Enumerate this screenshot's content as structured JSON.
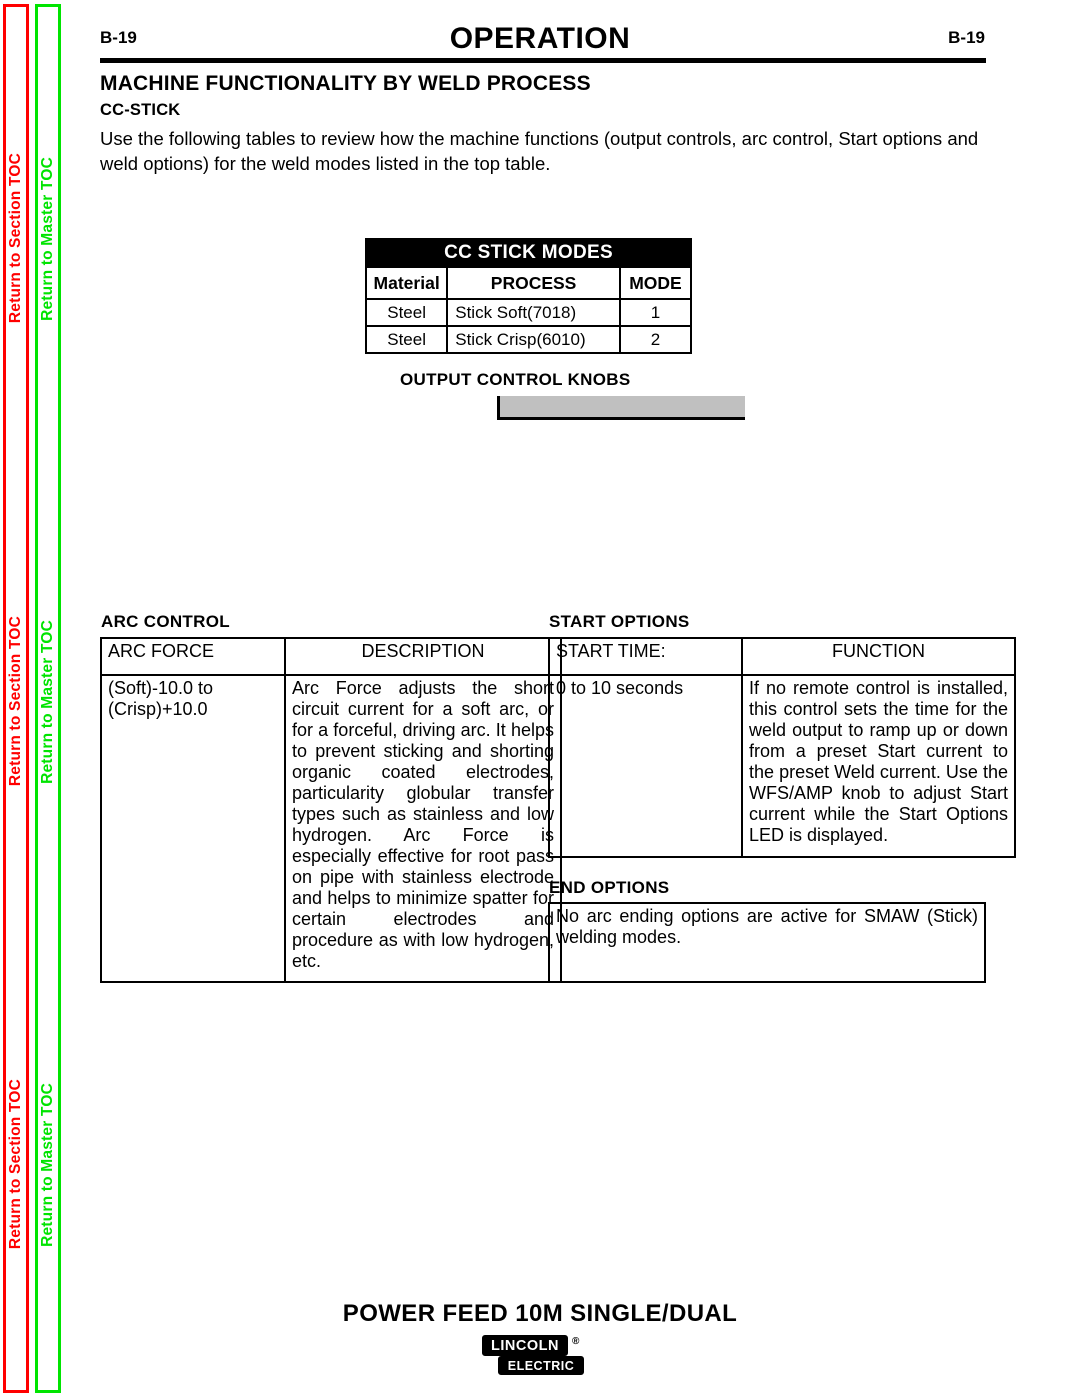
{
  "sidebar": {
    "bands": [
      {
        "section_toc": "Return to Section TOC",
        "master_toc": "Return to Master TOC"
      },
      {
        "section_toc": "Return to Section TOC",
        "master_toc": "Return to Master TOC"
      },
      {
        "section_toc": "Return to Section TOC",
        "master_toc": "Return to Master TOC"
      }
    ],
    "colors": {
      "section": "#ff0000",
      "master": "#00e400"
    }
  },
  "header": {
    "page_left": "B-19",
    "title": "OPERATION",
    "page_right": "B-19"
  },
  "headings": {
    "h1": "MACHINE FUNCTIONALITY BY WELD PROCESS",
    "h2": "CC-STICK"
  },
  "intro_paragraph": "Use the following tables to review how the machine functions (output controls, arc control, Start options and weld options) for the weld modes listed in the top table.",
  "cc_stick_modes": {
    "title": "CC STICK MODES",
    "columns": [
      "Material",
      "PROCESS",
      "MODE"
    ],
    "rows": [
      {
        "material": "Steel",
        "process": "Stick    Soft(7018)",
        "mode": "1"
      },
      {
        "material": "Steel",
        "process": "Stick    Crisp(6010)",
        "mode": "2"
      }
    ]
  },
  "output_control_knobs": {
    "label": "OUTPUT CONTROL KNOBS",
    "bar_color": "#c0c0c0"
  },
  "arc_control": {
    "label": "ARC CONTROL",
    "columns": [
      "ARC FORCE",
      "DESCRIPTION"
    ],
    "row": {
      "arc_force": "(Soft)-10.0  to (Crisp)+10.0",
      "description": "Arc Force adjusts the short circuit current for a soft arc, or for a forceful, driving arc. It helps to prevent sticking and shorting organic coated electrodes, particularity globular transfer types such as stainless and low hydrogen. Arc Force is especially effective for root pass on pipe with stainless electrode and helps to minimize spatter for certain electrodes and procedure as with low hydrogen, etc."
    }
  },
  "start_options": {
    "label": "START OPTIONS",
    "columns": [
      "START TIME:",
      "FUNCTION"
    ],
    "row": {
      "start_time": "0 to 10 seconds",
      "function": "If no remote control is installed, this control sets the time for the weld output to ramp up or down from a preset Start current to the preset Weld current. Use the WFS/AMP knob to adjust Start current while the Start Options LED is displayed."
    }
  },
  "end_options": {
    "label": "END  OPTIONS",
    "text": "No arc ending options are active for SMAW (Stick) welding modes."
  },
  "footer": {
    "product_title": "POWER FEED 10M SINGLE/DUAL",
    "logo_top": "LINCOLN",
    "logo_bottom": "ELECTRIC",
    "logo_registered": "®"
  }
}
